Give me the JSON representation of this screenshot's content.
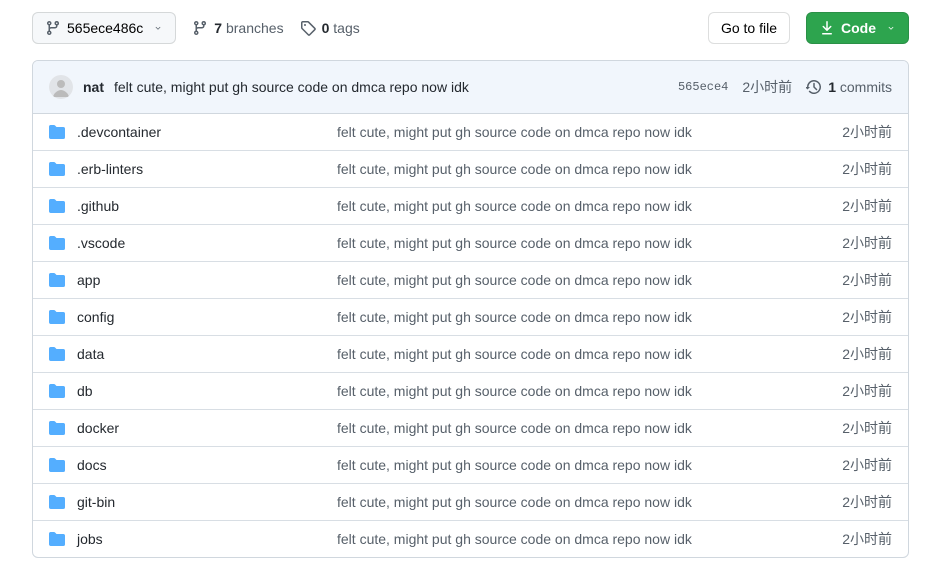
{
  "branch": {
    "label": "565ece486c"
  },
  "meta": {
    "branches_count": "7",
    "branches_label": "branches",
    "tags_count": "0",
    "tags_label": "tags"
  },
  "actions": {
    "go_to_file": "Go to file",
    "code": "Code"
  },
  "commit_bar": {
    "author": "nat",
    "message": "felt cute, might put gh source code on dmca repo now idk",
    "short_sha": "565ece4",
    "time": "2小时前",
    "commits_count": "1",
    "commits_label": "commits"
  },
  "files": [
    {
      "name": ".devcontainer",
      "msg": "felt cute, might put gh source code on dmca repo now idk",
      "time": "2小时前"
    },
    {
      "name": ".erb-linters",
      "msg": "felt cute, might put gh source code on dmca repo now idk",
      "time": "2小时前"
    },
    {
      "name": ".github",
      "msg": "felt cute, might put gh source code on dmca repo now idk",
      "time": "2小时前"
    },
    {
      "name": ".vscode",
      "msg": "felt cute, might put gh source code on dmca repo now idk",
      "time": "2小时前"
    },
    {
      "name": "app",
      "msg": "felt cute, might put gh source code on dmca repo now idk",
      "time": "2小时前"
    },
    {
      "name": "config",
      "msg": "felt cute, might put gh source code on dmca repo now idk",
      "time": "2小时前"
    },
    {
      "name": "data",
      "msg": "felt cute, might put gh source code on dmca repo now idk",
      "time": "2小时前"
    },
    {
      "name": "db",
      "msg": "felt cute, might put gh source code on dmca repo now idk",
      "time": "2小时前"
    },
    {
      "name": "docker",
      "msg": "felt cute, might put gh source code on dmca repo now idk",
      "time": "2小时前"
    },
    {
      "name": "docs",
      "msg": "felt cute, might put gh source code on dmca repo now idk",
      "time": "2小时前"
    },
    {
      "name": "git-bin",
      "msg": "felt cute, might put gh source code on dmca repo now idk",
      "time": "2小时前"
    },
    {
      "name": "jobs",
      "msg": "felt cute, might put gh source code on dmca repo now idk",
      "time": "2小时前"
    }
  ]
}
